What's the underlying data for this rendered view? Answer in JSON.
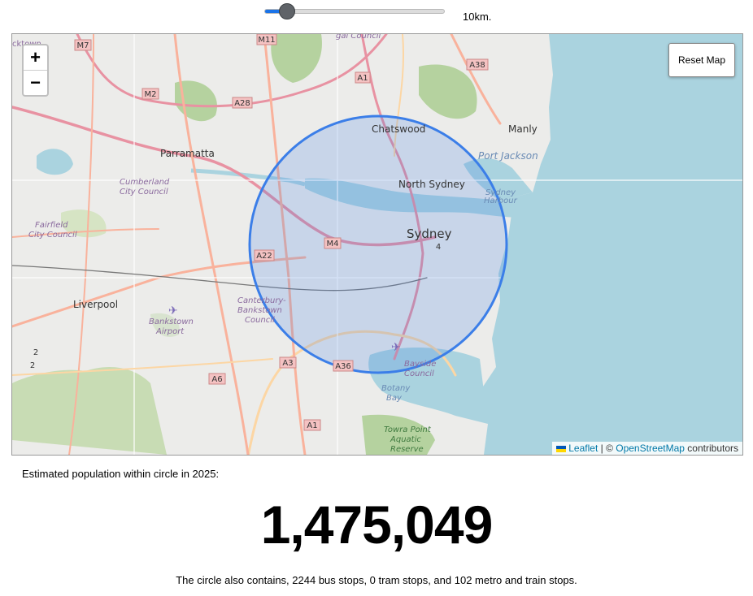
{
  "slider": {
    "value_label": "10km.",
    "fraction": 0.1
  },
  "map": {
    "reset_label": "Reset Map",
    "zoom_in_label": "+",
    "zoom_out_label": "−",
    "attribution": {
      "leaflet": "Leaflet",
      "sep": " | © ",
      "osm": "OpenStreetMap",
      "suffix": " contributors"
    },
    "circle_color": "#3b7ee8",
    "places": {
      "chatswood": "Chatswood",
      "manly": "Manly",
      "parramatta": "Parramatta",
      "north_sydney": "North Sydney",
      "sydney": "Sydney",
      "port_jackson": "Port Jackson",
      "sydney_harbour_1": "Sydney",
      "sydney_harbour_2": "Harbour",
      "cumberland_1": "Cumberland",
      "cumberland_2": "City Council",
      "fairfield_1": "Fairfield",
      "fairfield_2": "City Council",
      "liverpool": "Liverpool",
      "bankstown_1": "Bankstown",
      "bankstown_2": "Airport",
      "canterbury_1": "Canterbury-",
      "canterbury_2": "Bankstown",
      "canterbury_3": "Council",
      "bayside_1": "Bayside",
      "bayside_2": "Council",
      "botany_1": "Botany",
      "botany_2": "Bay",
      "towra_1": "Towra Point",
      "towra_2": "Aquatic",
      "towra_3": "Reserve",
      "council_top": "gal Council",
      "cks": "cktown"
    },
    "roads": {
      "m7": "M7",
      "m11": "M11",
      "a38": "A38",
      "m2": "M2",
      "a1_top": "A1",
      "a28": "A28",
      "m4": "M4",
      "a22": "A22",
      "a3": "A3",
      "a6": "A6",
      "a36": "A36",
      "a1_bottom": "A1",
      "r4": "4",
      "r2a": "2",
      "r2b": "2"
    }
  },
  "population": {
    "label": "Estimated population within circle in 2025:",
    "value": "1,475,049"
  },
  "stops": {
    "text": "The circle also contains, 2244 bus stops, 0 tram stops, and 102 metro and train stops."
  }
}
